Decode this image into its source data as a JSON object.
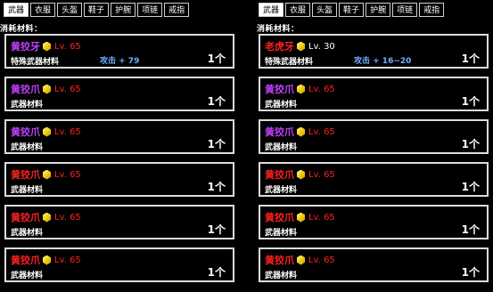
{
  "tabs": [
    "武器",
    "衣服",
    "头盔",
    "鞋子",
    "护腕",
    "项链",
    "戒指"
  ],
  "active_tab": "武器",
  "consume_label": "消耗材料：",
  "colors": {
    "purple": "#c040ff",
    "red": "#ff2020",
    "white": "#ffffff",
    "stat_blue": "#6fb0ff",
    "gem_yellow": "#f5d51a"
  },
  "left_panel": {
    "cards": [
      {
        "name": "黄狡牙",
        "name_color": "#c040ff",
        "level": "Lv. 65",
        "level_color": "#ff2020",
        "type": "特殊武器材料",
        "stat": "攻击 + 79",
        "qty": "1个"
      },
      {
        "name": "黄狡爪",
        "name_color": "#c040ff",
        "level": "Lv. 65",
        "level_color": "#ff2020",
        "type": "武器材料",
        "stat": "",
        "qty": "1个"
      },
      {
        "name": "黄狡爪",
        "name_color": "#c040ff",
        "level": "Lv. 65",
        "level_color": "#ff2020",
        "type": "武器材料",
        "stat": "",
        "qty": "1个"
      },
      {
        "name": "黄狡爪",
        "name_color": "#ff2020",
        "level": "Lv. 65",
        "level_color": "#ff2020",
        "type": "武器材料",
        "stat": "",
        "qty": "1个"
      },
      {
        "name": "黄狡爪",
        "name_color": "#ff2020",
        "level": "Lv. 65",
        "level_color": "#ff2020",
        "type": "武器材料",
        "stat": "",
        "qty": "1个"
      },
      {
        "name": "黄狡爪",
        "name_color": "#ff2020",
        "level": "Lv. 65",
        "level_color": "#ff2020",
        "type": "武器材料",
        "stat": "",
        "qty": "1个"
      }
    ]
  },
  "right_panel": {
    "cards": [
      {
        "name": "老虎牙",
        "name_color": "#ff2020",
        "level": "Lv. 30",
        "level_color": "#ffffff",
        "type": "特殊武器材料",
        "stat": "攻击 + 16~20",
        "qty": "1个"
      },
      {
        "name": "黄狡爪",
        "name_color": "#c040ff",
        "level": "Lv. 65",
        "level_color": "#ff2020",
        "type": "武器材料",
        "stat": "",
        "qty": "1个"
      },
      {
        "name": "黄狡爪",
        "name_color": "#c040ff",
        "level": "Lv. 65",
        "level_color": "#ff2020",
        "type": "武器材料",
        "stat": "",
        "qty": "1个"
      },
      {
        "name": "黄狡爪",
        "name_color": "#ff2020",
        "level": "Lv. 65",
        "level_color": "#ff2020",
        "type": "武器材料",
        "stat": "",
        "qty": "1个"
      },
      {
        "name": "黄狡爪",
        "name_color": "#ff2020",
        "level": "Lv. 65",
        "level_color": "#ff2020",
        "type": "武器材料",
        "stat": "",
        "qty": "1个"
      },
      {
        "name": "黄狡爪",
        "name_color": "#ff2020",
        "level": "Lv. 65",
        "level_color": "#ff2020",
        "type": "武器材料",
        "stat": "",
        "qty": "1个"
      }
    ]
  }
}
